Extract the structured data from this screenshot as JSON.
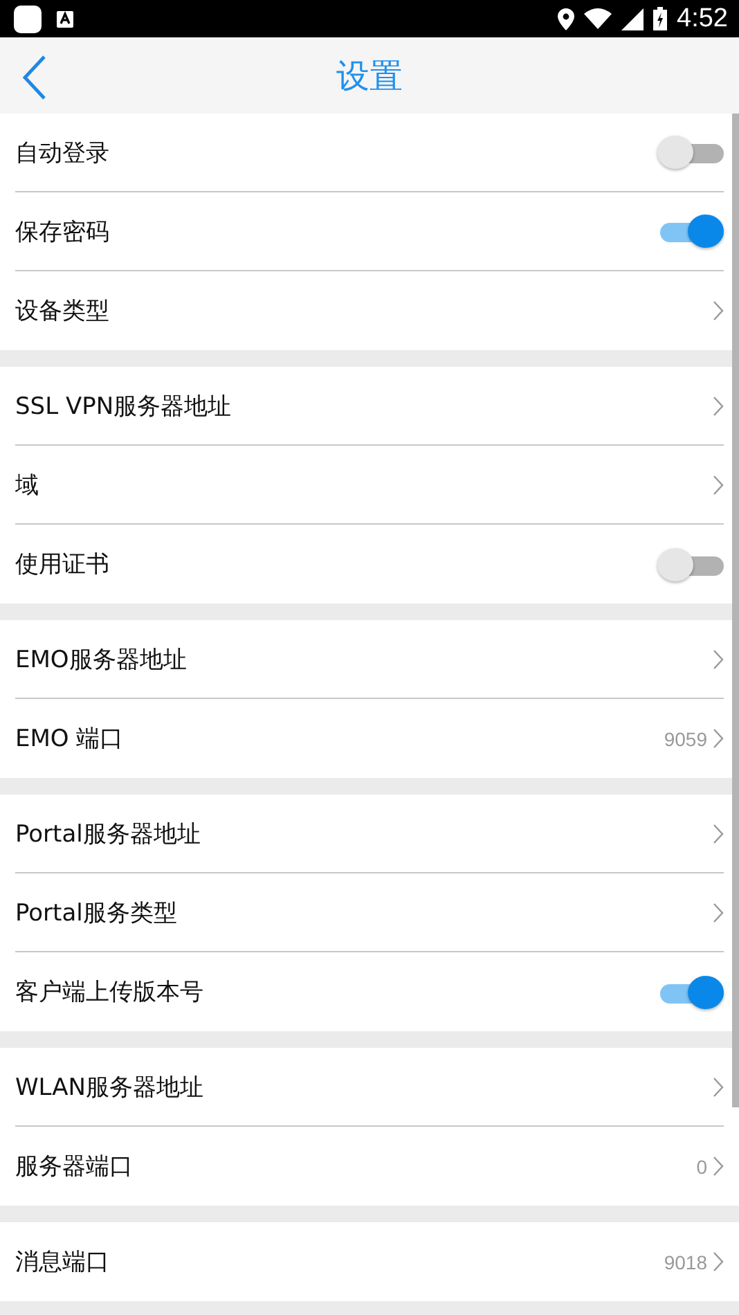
{
  "status_bar": {
    "time": "4:52"
  },
  "header": {
    "title": "设置"
  },
  "groups": [
    {
      "items": [
        {
          "kind": "toggle",
          "label": "自动登录",
          "on": false
        },
        {
          "kind": "toggle",
          "label": "保存密码",
          "on": true
        },
        {
          "kind": "link",
          "label": "设备类型"
        }
      ]
    },
    {
      "items": [
        {
          "kind": "link",
          "label": "SSL VPN服务器地址"
        },
        {
          "kind": "link",
          "label": "域"
        },
        {
          "kind": "toggle",
          "label": "使用证书",
          "on": false
        }
      ]
    },
    {
      "items": [
        {
          "kind": "link",
          "label": "EMO服务器地址"
        },
        {
          "kind": "link",
          "label": "EMO 端口",
          "value": "9059"
        }
      ]
    },
    {
      "items": [
        {
          "kind": "link",
          "label": "Portal服务器地址"
        },
        {
          "kind": "link",
          "label": "Portal服务类型"
        },
        {
          "kind": "toggle",
          "label": "客户端上传版本号",
          "on": true
        }
      ]
    },
    {
      "items": [
        {
          "kind": "link",
          "label": "WLAN服务器地址"
        },
        {
          "kind": "link",
          "label": "服务器端口",
          "value": "0"
        }
      ]
    },
    {
      "items": [
        {
          "kind": "link",
          "label": "消息端口",
          "value": "9018"
        }
      ]
    }
  ]
}
